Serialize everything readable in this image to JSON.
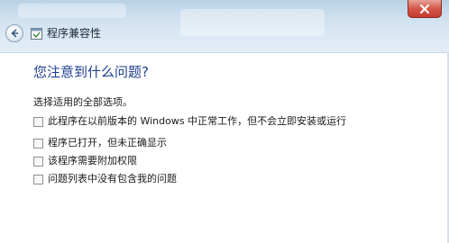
{
  "window": {
    "title": "程序兼容性"
  },
  "question": {
    "heading": "您注意到什么问题?",
    "instruction": "选择适用的全部选项。"
  },
  "options": [
    {
      "label": "此程序在以前版本的 Windows 中正常工作，但不会立即安装或运行",
      "checked": false
    },
    {
      "label": "程序已打开，但未正确显示",
      "checked": false
    },
    {
      "label": "该程序需要附加权限",
      "checked": false
    },
    {
      "label": "问题列表中没有包含我的问题",
      "checked": false
    }
  ],
  "colors": {
    "heading": "#1e3f8f",
    "titlebar": "#cfe0ef",
    "close_button": "#c43c2f"
  },
  "icons": {
    "back": "back-arrow-icon",
    "app": "compatibility-app-icon",
    "close": "close-icon"
  }
}
